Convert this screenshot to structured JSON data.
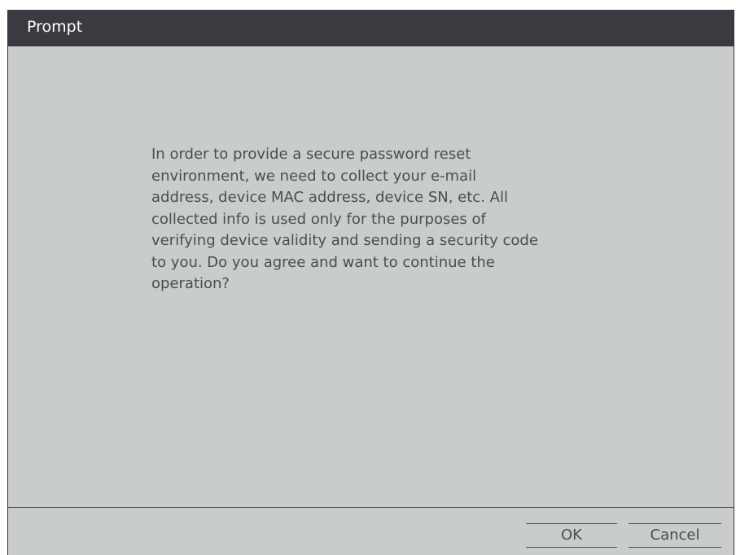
{
  "dialog": {
    "title": "Prompt",
    "message": "In order to provide a secure password reset\nenvironment, we need to collect your e-mail\naddress, device MAC address, device SN, etc. All\ncollected info is used only for the purposes of\nverifying device validity and sending a security code\n to you. Do you agree and want to continue the\noperation?",
    "buttons": {
      "ok_label": "OK",
      "cancel_label": "Cancel"
    }
  },
  "colors": {
    "titlebar": "#3a3b40",
    "title_text": "#ffffff",
    "body_background": "#c8cdcb",
    "body_text": "#4a4d52"
  }
}
